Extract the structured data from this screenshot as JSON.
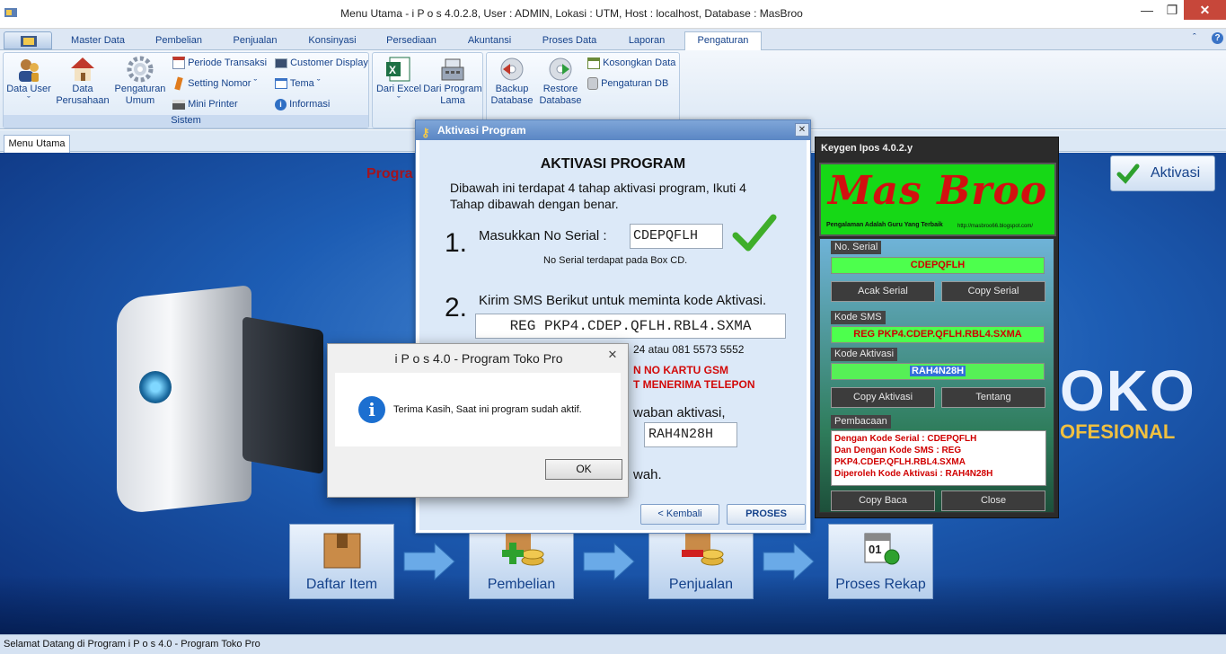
{
  "window": {
    "title": "Menu Utama - i P o s 4.0.2.8,  User : ADMIN, Lokasi : UTM, Host : localhost, Database : MasBroo"
  },
  "ribbon": {
    "tabs": [
      "Master Data",
      "Pembelian",
      "Penjualan",
      "Konsinyasi",
      "Persediaan",
      "Akuntansi",
      "Proses Data",
      "Laporan",
      "Pengaturan"
    ],
    "active_tab": "Pengaturan",
    "group_sistem": {
      "label": "Sistem",
      "data_user": "Data User",
      "data_perusahaan_1": "Data",
      "data_perusahaan_2": "Perusahaan",
      "pengaturan_umum_1": "Pengaturan",
      "pengaturan_umum_2": "Umum",
      "periode_transaksi": "Periode Transaksi",
      "setting_nomor": "Setting Nomor",
      "mini_printer": "Mini Printer",
      "customer_display": "Customer Display",
      "tema": "Tema",
      "informasi": "Informasi"
    },
    "group_import": {
      "dari_excel": "Dari Excel",
      "dari_program_1": "Dari Program",
      "dari_program_2": "Lama"
    },
    "group_db": {
      "backup_1": "Backup",
      "backup_2": "Database",
      "restore_1": "Restore",
      "restore_2": "Database",
      "kosongkan": "Kosongkan Data",
      "pengaturan_db": "Pengaturan DB"
    }
  },
  "doc_tab": "Menu Utama",
  "main": {
    "program_text": "Progra",
    "toko_text": "OKO",
    "profesional_text": "OFESIONAL",
    "aktivasi_button": "Aktivasi",
    "flow": [
      "Daftar Item",
      "Pembelian",
      "Penjualan",
      "Proses Rekap"
    ]
  },
  "activation_dialog": {
    "caption": "Aktivasi Program",
    "heading": "AKTIVASI PROGRAM",
    "intro": "Dibawah ini terdapat 4 tahap aktivasi program, Ikuti 4 Tahap dibawah dengan benar.",
    "step1_num": "1.",
    "step1_label": "Masukkan No Serial :",
    "serial": "CDEPQFLH",
    "serial_note": "No Serial terdapat pada Box CD.",
    "step2_num": "2.",
    "step2_label": "Kirim SMS Berikut untuk meminta kode Aktivasi.",
    "sms_code": "REG PKP4.CDEP.QFLH.RBL4.SXMA",
    "phone_partial": "24 atau 081 5573 5552",
    "warn1": "N NO KARTU GSM",
    "warn2": "T MENERIMA TELEPON",
    "step3_partial": "waban aktivasi,",
    "activation_code": "RAH4N28H",
    "step4_partial": "wah.",
    "back_button": "< Kembali",
    "proses_button": "PROSES"
  },
  "message_box": {
    "title": "i P o s  4.0 - Program Toko Pro",
    "message": "Terima Kasih, Saat ini program sudah aktif.",
    "ok_button": "OK"
  },
  "keygen": {
    "title": "Keygen Ipos 4.0.2.y",
    "logo_text": "Mas Broo",
    "logo_tagline": "Pengalaman Adalah Guru Yang Terbaik",
    "logo_url": "http://masbroo66.blogspot.com/",
    "no_serial_label": "No. Serial",
    "no_serial": "CDEPQFLH",
    "acak_button": "Acak Serial",
    "copy_serial_button": "Copy Serial",
    "kode_sms_label": "Kode SMS",
    "kode_sms": "REG PKP4.CDEP.QFLH.RBL4.SXMA",
    "kode_aktivasi_label": "Kode Aktivasi",
    "kode_aktivasi": "RAH4N28H",
    "copy_aktivasi_button": "Copy Aktivasi",
    "tentang_button": "Tentang",
    "pembacaan_label": "Pembacaan",
    "pembacaan_1": "Dengan Kode Serial : CDEPQFLH",
    "pembacaan_2": "Dan Dengan Kode SMS : REG PKP4.CDEP.QFLH.RBL4.SXMA",
    "pembacaan_3": "Diperoleh Kode Aktivasi : RAH4N28H",
    "copy_baca_button": "Copy Baca",
    "close_button": "Close"
  },
  "status_bar": "Selamat Datang di Program i P o s  4.0 - Program Toko Pro"
}
